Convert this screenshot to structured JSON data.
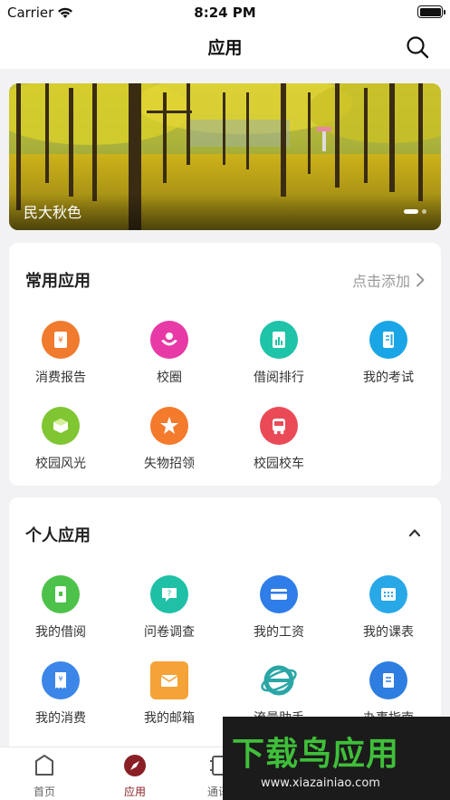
{
  "status_bar": {
    "carrier": "Carrier",
    "time": "8:24 PM"
  },
  "nav": {
    "title": "应用"
  },
  "banner": {
    "caption": "民大秋色",
    "page_count": 2,
    "active_page": 1
  },
  "common_apps": {
    "title": "常用应用",
    "action_label": "点击添加",
    "items": [
      {
        "label": "消费报告",
        "icon": "report-icon",
        "color": "#f07a2e"
      },
      {
        "label": "校圈",
        "icon": "campus-circle-icon",
        "color": "#e83aa6"
      },
      {
        "label": "借阅排行",
        "icon": "ranking-icon",
        "color": "#1fc3a7"
      },
      {
        "label": "我的考试",
        "icon": "exam-icon",
        "color": "#1aa6e6"
      },
      {
        "label": "校园风光",
        "icon": "scenery-icon",
        "color": "#7fc632"
      },
      {
        "label": "失物招领",
        "icon": "lost-found-icon",
        "color": "#f47a2c"
      },
      {
        "label": "校园校车",
        "icon": "bus-icon",
        "color": "#ea4a56"
      }
    ]
  },
  "personal_apps": {
    "title": "个人应用",
    "items": [
      {
        "label": "我的借阅",
        "icon": "borrow-icon",
        "color": "#4dc24a"
      },
      {
        "label": "问卷调查",
        "icon": "survey-icon",
        "color": "#1fc0a6"
      },
      {
        "label": "我的工资",
        "icon": "salary-icon",
        "color": "#2f7de8"
      },
      {
        "label": "我的课表",
        "icon": "schedule-icon",
        "color": "#29a8e8"
      },
      {
        "label": "我的消费",
        "icon": "consumption-icon",
        "color": "#3b86e8"
      },
      {
        "label": "我的邮箱",
        "icon": "mail-icon",
        "color": "#f5a236"
      },
      {
        "label": "流量助手",
        "icon": "traffic-icon",
        "color": "#2aa6a6"
      },
      {
        "label": "办事指南",
        "icon": "guide-icon",
        "color": "#2e7de0"
      }
    ]
  },
  "tabbar": {
    "items": [
      {
        "label": "首页",
        "icon": "home-icon"
      },
      {
        "label": "应用",
        "icon": "compass-icon"
      },
      {
        "label": "通讯",
        "icon": "contacts-icon"
      }
    ],
    "active_color": "#8a1f26"
  },
  "watermark": {
    "title": "下载鸟应用",
    "url": "www.xiazainiao.com"
  }
}
